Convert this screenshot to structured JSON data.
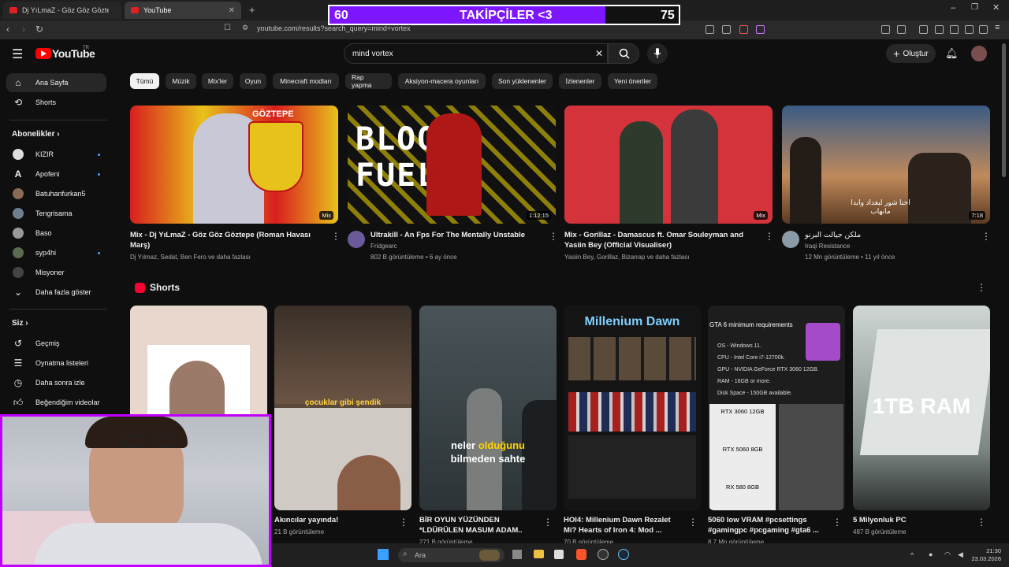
{
  "browser": {
    "tabs": [
      {
        "label": "Dj YıLmaZ - Göz Göz Göztepe (Ro..."
      },
      {
        "label": "YouTube"
      }
    ],
    "url": "youtube.com/results?search_query=mind+vortex"
  },
  "overlay": {
    "left": "60",
    "label": "TAKİPÇİLER <3",
    "right": "75",
    "progress_percent": 79
  },
  "header": {
    "logo": "YouTube",
    "logo_region": "TR",
    "search_value": "mind vortex",
    "create_label": "Oluştur"
  },
  "sidebar": {
    "main": [
      {
        "label": "Ana Sayfa",
        "icon": "home-icon"
      },
      {
        "label": "Shorts",
        "icon": "shorts-icon"
      }
    ],
    "subs_heading": "Abonelikler",
    "subs": [
      {
        "label": "KIZIR"
      },
      {
        "label": "Apofeni"
      },
      {
        "label": "Batuhanfurkan5"
      },
      {
        "label": "Tengrisama"
      },
      {
        "label": "Baso"
      },
      {
        "label": "syp4hi"
      },
      {
        "label": "Misyoner"
      },
      {
        "label": "Daha fazla göster"
      }
    ],
    "you_heading": "Siz",
    "you": [
      {
        "label": "Geçmiş",
        "icon": "history-icon"
      },
      {
        "label": "Oynatma listeleri",
        "icon": "playlist-icon"
      },
      {
        "label": "Daha sonra izle",
        "icon": "clock-icon"
      },
      {
        "label": "Beğendiğim videolar",
        "icon": "thumbs-up-icon"
      }
    ]
  },
  "chips": [
    "Tümü",
    "Müzik",
    "Mix'ler",
    "Oyun",
    "Minecraft modları",
    "Rap yapma",
    "Aksiyon-macera oyunları",
    "Son yüklenenler",
    "İzlenenler",
    "Yeni öneriler"
  ],
  "videos": [
    {
      "title": "Mix - Dj YıLmaZ - Göz Göz Göztepe (Roman Havası Marş)",
      "meta": "Dj Yılmaz, Sedat, Ben Fero ve daha fazlası",
      "badge": "Mix",
      "thumb_text": "GÖZTEPE"
    },
    {
      "title": "Ultrakill - An Fps For The Mentally Unstable",
      "channel": "Fridgearc",
      "meta": "802 B görüntüleme • 6 ay önce",
      "badge": "1:12:15",
      "thumb_text": "BLOOD FUEL"
    },
    {
      "title": "Mix - Gorillaz - Damascus ft. Omar Souleyman and Yasiin Bey (Official Visualiser)",
      "meta": "Yasiin Bey, Gorillaz, Bizarrap ve daha fazlası",
      "badge": "Mix"
    },
    {
      "title": "ملكن جيالت البرنو",
      "channel": "Iraqi Resistance",
      "meta": "12 Mn görüntüleme • 11 yıl önce",
      "badge": "7:18",
      "thumb_text": "اخنا شور لبغداد وابدا مانهاب"
    }
  ],
  "shorts_heading": "Shorts",
  "shorts": [
    {
      "title": "",
      "meta": ""
    },
    {
      "title": "Akıncılar yayında!",
      "meta": "21 B görüntüleme",
      "thumb_text": "çocuklar gibi şendik"
    },
    {
      "title": "BİR OYUN YÜZÜNDEN *LDÜRÜLEN MASUM ADAM..",
      "meta": "271 B görüntüleme",
      "thumb_text_white": "neler",
      "thumb_text_yellow": "olduğunu",
      "thumb_text_line2": "bilmeden sahte"
    },
    {
      "title": "HOI4: Millenium Dawn Rezalet Mi? Hearts of Iron 4: Mod ...",
      "meta": "70 B görüntüleme",
      "thumb_text": "Millenium Dawn"
    },
    {
      "title": "5060 low VRAM #pcsettings #gamingpc #pcgaming #gta6 ...",
      "meta": "8,7 Mn görüntüleme",
      "thumb_head": "GTA 6 minimum requirements",
      "thumb_lines": [
        "OS - Windows 11.",
        "CPU - Intel Core i7-12700k.",
        "GPU - NVIDIA GeForce RTX 3060 12GB.",
        "RAM - 16GB or more.",
        "Disk Space - 150GB available."
      ],
      "cards": [
        "RTX 3060 12GB",
        "RTX 5060 8GB",
        "RX 580 8GB"
      ]
    },
    {
      "title": "5 Milyonluk PC",
      "meta": "487 B görüntüleme",
      "thumb_text": "1TB RAM"
    }
  ],
  "taskbar": {
    "search": "Ara",
    "time": "21:30",
    "date": "23.03.2026"
  }
}
